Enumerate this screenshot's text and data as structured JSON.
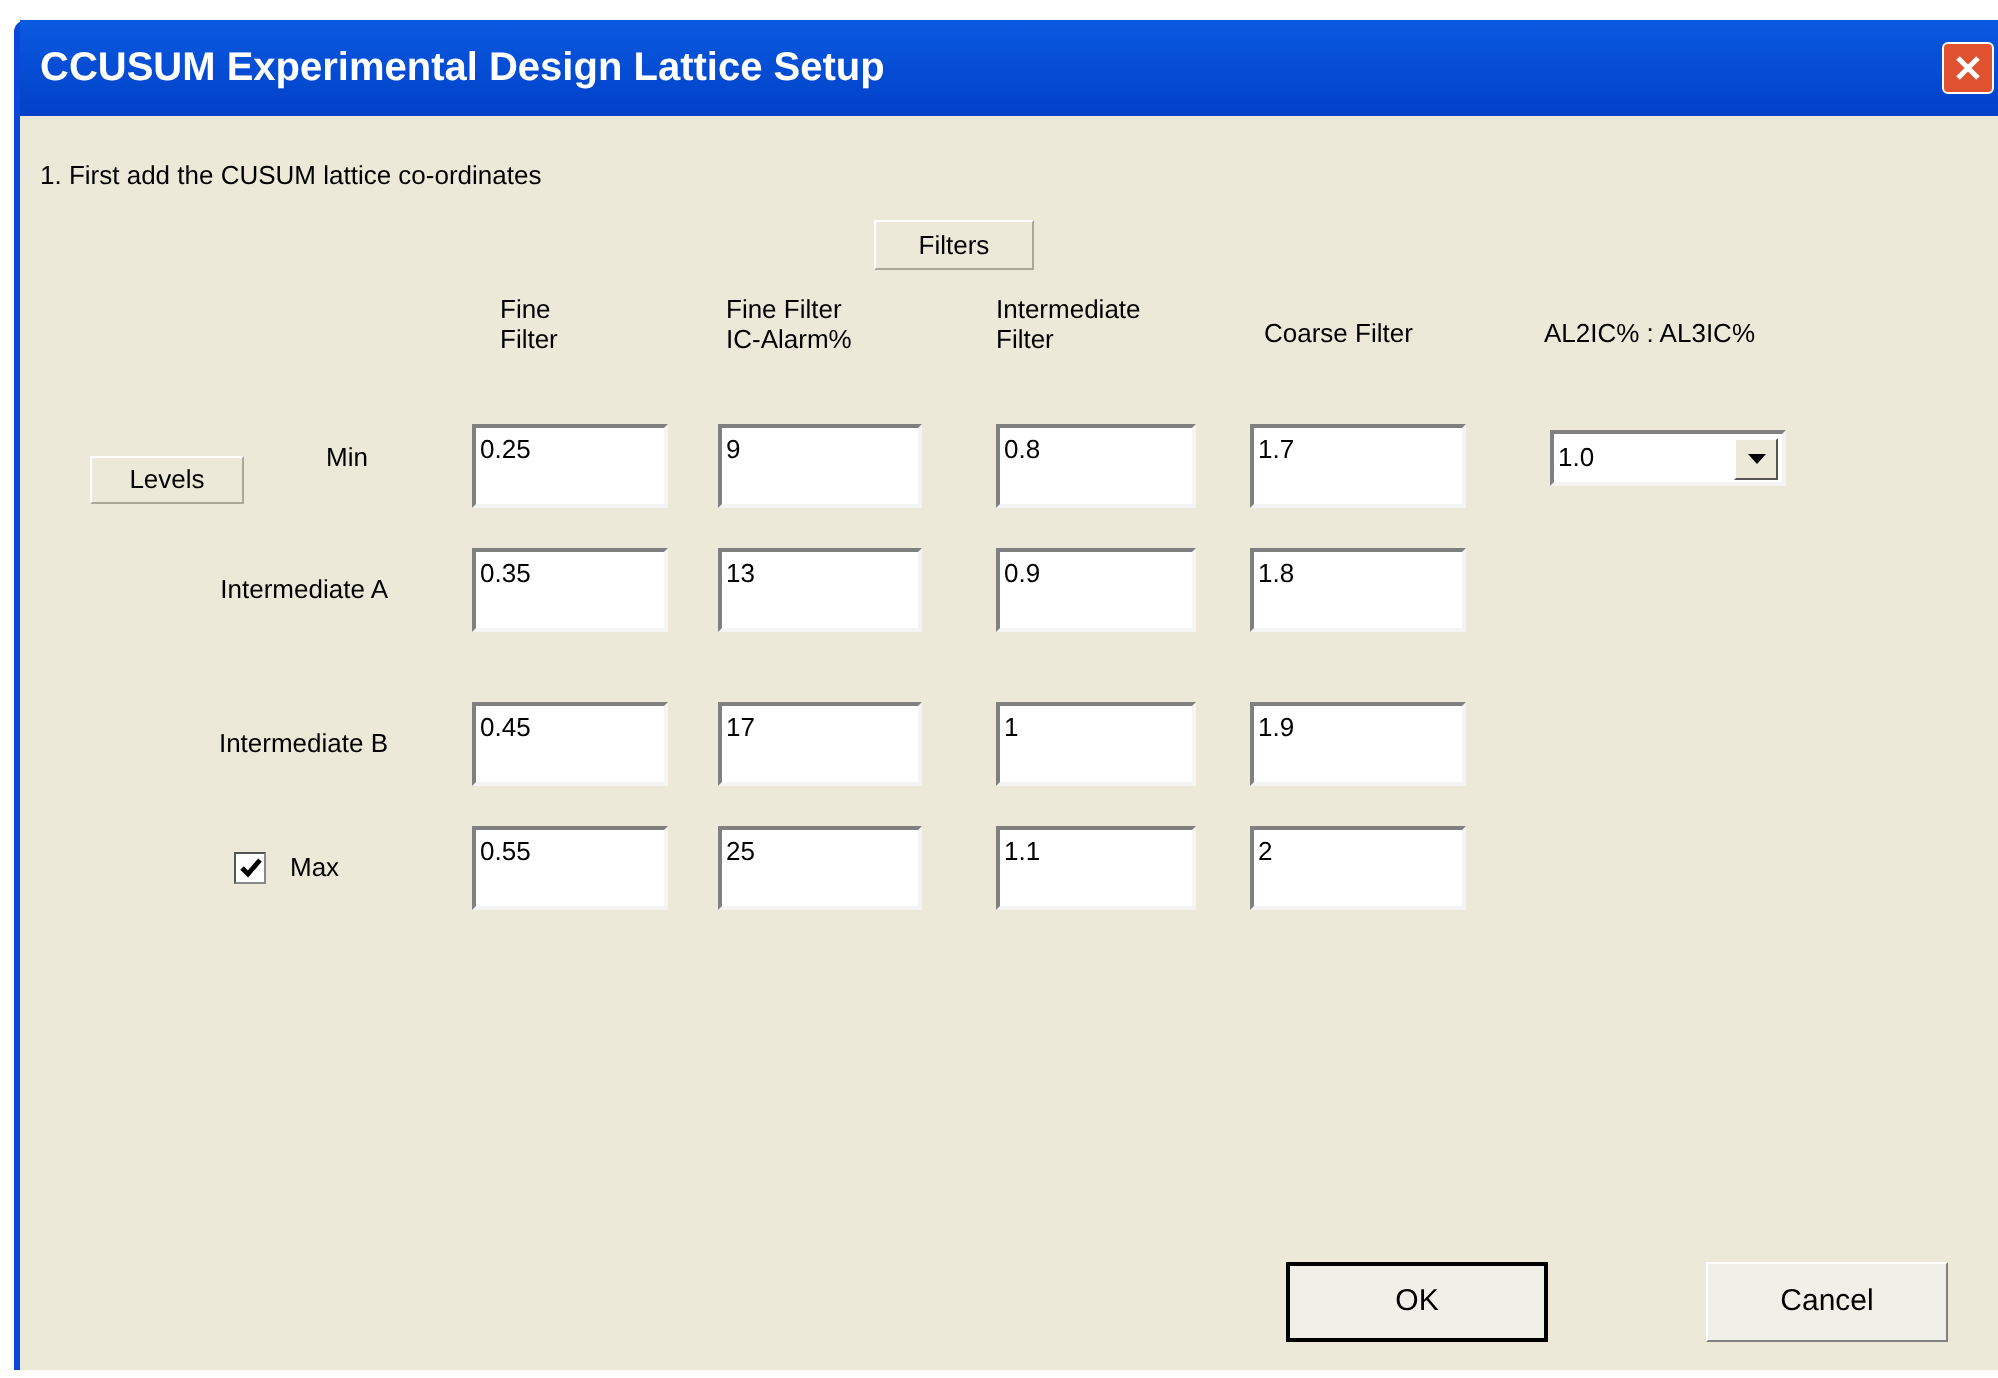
{
  "window": {
    "title": "CCUSUM Experimental Design Lattice Setup"
  },
  "instruction": "1. First add the CUSUM lattice co-ordinates",
  "filters_label": "Filters",
  "levels_label": "Levels",
  "columns": [
    "Fine Filter",
    "Fine Filter IC-Alarm%",
    "Intermediate Filter",
    "Coarse Filter",
    "AL2IC% : AL3IC%"
  ],
  "rows": [
    {
      "kind": "plain",
      "label": "Min",
      "values": [
        "0.25",
        "9",
        "0.8",
        "1.7"
      ]
    },
    {
      "kind": "plain",
      "label": "Intermediate A",
      "values": [
        "0.35",
        "13",
        "0.9",
        "1.8"
      ]
    },
    {
      "kind": "plain",
      "label": "Intermediate B",
      "values": [
        "0.45",
        "17",
        "1",
        "1.9"
      ]
    },
    {
      "kind": "checkbox",
      "label": "Max",
      "checked": true,
      "values": [
        "0.55",
        "25",
        "1.1",
        "2"
      ]
    }
  ],
  "ratio_dropdown": {
    "value": "1.0"
  },
  "buttons": [
    {
      "label": "OK",
      "default": true
    },
    {
      "label": "Cancel",
      "default": false
    }
  ]
}
